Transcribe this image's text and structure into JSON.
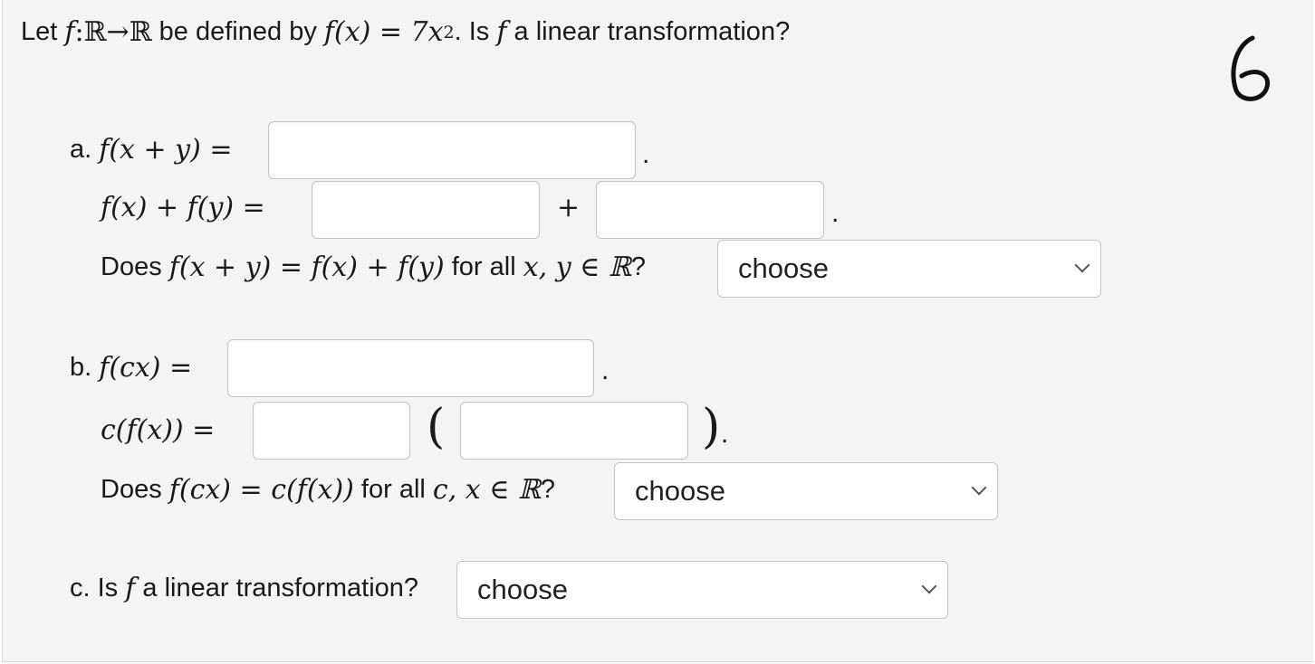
{
  "question": {
    "text_let": "Let",
    "f": "f",
    "colon": " : ",
    "domain": "ℝ",
    "arrow": " → ",
    "codomain": "ℝ",
    "text_defined": " be defined by ",
    "fx": "f(x) = 7x",
    "exp": "2",
    "text_is": ". Is ",
    "f2": "f",
    "text_linear": " a linear transformation?"
  },
  "part_a": {
    "label": "a.",
    "lhs": "f(x + y) =",
    "sum_lhs": "f(x) + f(y) =",
    "plus": "+",
    "question_pre": "Does ",
    "question_math": "f(x + y) = f(x) + f(y)",
    "question_mid": " for all ",
    "question_vars": "x, y ∈ ℝ",
    "question_end": "?",
    "select_value": "choose"
  },
  "part_b": {
    "label": "b.",
    "lhs": "f(cx) =",
    "scalar_lhs": "c(f(x)) =",
    "open_paren": "(",
    "close_paren": ")",
    "question_pre": "Does ",
    "question_math": "f(cx) = c(f(x))",
    "question_mid": " for all ",
    "question_vars": "c, x ∈ ℝ",
    "question_end": "?",
    "select_value": "choose"
  },
  "part_c": {
    "label": "c. Is ",
    "f": "f",
    "rest": " a linear transformation?",
    "select_value": "choose"
  },
  "period": ".",
  "handwritten_mark": "6",
  "colors": {
    "background": "#f4f4f4",
    "field_border": "#c4c4c4"
  }
}
